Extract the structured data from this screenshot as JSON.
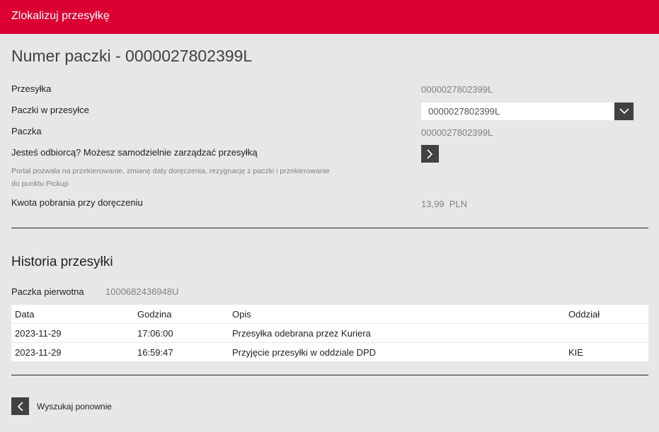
{
  "header": {
    "title": "Zlokalizuj przesyłkę"
  },
  "page": {
    "heading": "Numer paczki - 0000027802399L"
  },
  "details": {
    "shipment_label": "Przesyłka",
    "shipment_value": "0000027802399L",
    "parcels_label": "Paczki w przesyłce",
    "parcels_selected": "0000027802399L",
    "parcel_label": "Paczka",
    "parcel_value": "0000027802399L",
    "recipient_label": "Jesteś odbiorcą? Możesz samodzielnie zarządzać przesyłką",
    "portal_note": "Portal pozwala na przekierowanie, zmianę daty doręczenia, rezygnację z paczki i przekierowanie do punktu Pickup",
    "cod_label": "Kwota pobrania przy doręczeniu",
    "cod_value": "13,99  PLN"
  },
  "history": {
    "title": "Historia przesyłki",
    "original_label": "Paczka pierwotna",
    "original_value": "1000682436948U",
    "columns": [
      "Data",
      "Godzina",
      "Opis",
      "Oddział"
    ],
    "rows": [
      [
        "2023-11-29",
        "17:06:00",
        "Przesyłka odebrana przez Kuriera",
        ""
      ],
      [
        "2023-11-29",
        "16:59:47",
        "Przyjęcie przesyłki w oddziale DPD",
        "KIE"
      ]
    ]
  },
  "footer": {
    "search_again": "Wyszukaj ponownie"
  },
  "colors": {
    "brand": "#dc0032",
    "dark": "#414042",
    "background": "#e6e7e6"
  },
  "icons": {
    "dropdown": "chevron-down-icon",
    "manage": "chevron-right-icon",
    "back": "chevron-left-icon"
  }
}
